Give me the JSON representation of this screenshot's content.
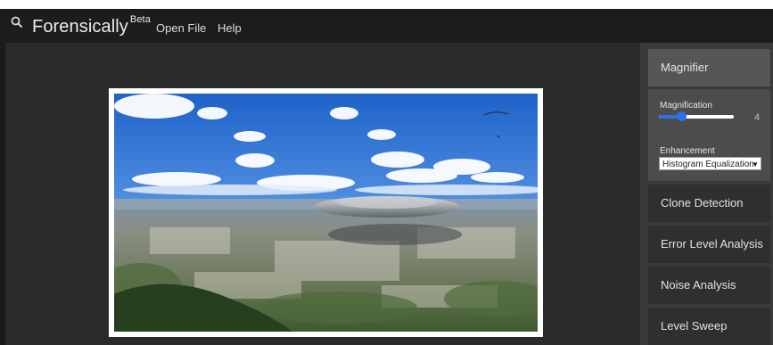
{
  "header": {
    "app_name": "Forensically",
    "app_badge": "Beta",
    "search_icon": "search-icon",
    "menu": [
      {
        "label": "Open File"
      },
      {
        "label": "Help"
      }
    ]
  },
  "workspace": {
    "image_description_icon": "photo-ufo-over-city"
  },
  "tools": {
    "magnifier": {
      "label": "Magnifier",
      "magnification_label": "Magnification",
      "magnification_value": "4",
      "magnification_fraction": 0.3,
      "enhancement_label": "Enhancement",
      "enhancement_selected": "Histogram Equalization"
    },
    "clone_detection": {
      "label": "Clone Detection"
    },
    "error_level_analysis": {
      "label": "Error Level Analysis"
    },
    "noise_analysis": {
      "label": "Noise Analysis"
    },
    "level_sweep": {
      "label": "Level Sweep"
    }
  },
  "colors": {
    "accent": "#2f6fe8",
    "topbar": "#1c1c1c",
    "panel": "#3a3a3a"
  }
}
